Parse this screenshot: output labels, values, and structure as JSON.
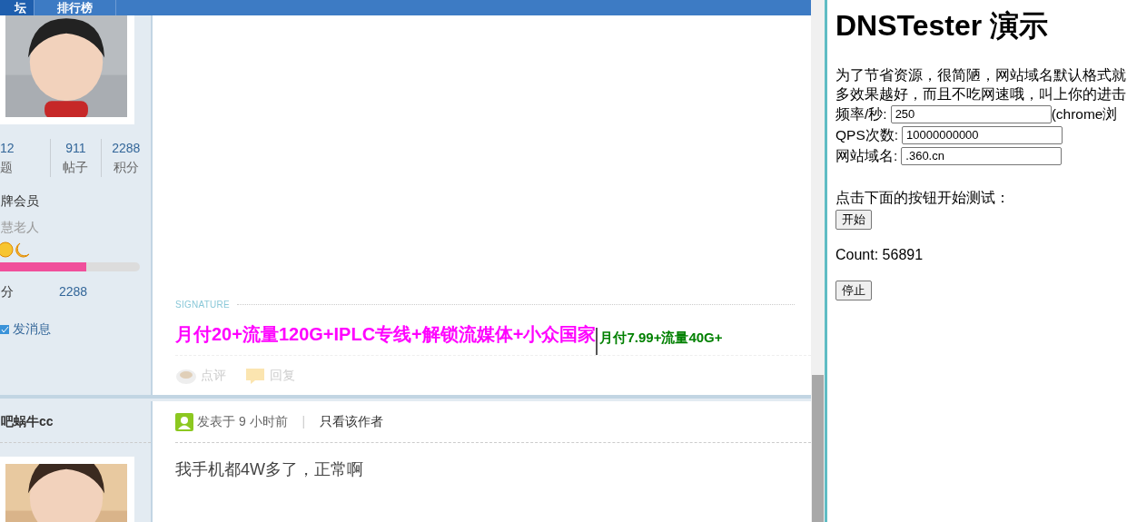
{
  "nav_tabs": [
    {
      "label": "坛",
      "selected": true
    },
    {
      "label": "排行榜",
      "selected": false
    }
  ],
  "post_1": {
    "author_stats": [
      {
        "value": "12",
        "label": "题"
      },
      {
        "value": "911",
        "label": "帖子"
      },
      {
        "value": "2288",
        "label": "积分"
      }
    ],
    "rank": "牌会员",
    "title": "慧老人",
    "level": 0.62,
    "points_label": "分",
    "points_value": "2288",
    "message_link": "发消息",
    "signature_label": "SIGNATURE",
    "signature_parts": [
      {
        "text": "月付20+流量120G+IPLC专线+解锁流媒体+小众国家",
        "color": "#ff00ff"
      },
      {
        "text": "月付7.99+流量40G+",
        "color": "#008000"
      }
    ],
    "actions": [
      {
        "kind": "rate",
        "label": "点评"
      },
      {
        "kind": "reply",
        "label": "回复"
      }
    ]
  },
  "post_2": {
    "author": "吧蜗牛cc",
    "posted": "发表于 9 小时前",
    "separator": "|",
    "author_only": "只看该作者",
    "content": "我手机都4W多了，正常啊"
  },
  "dns_panel": {
    "title": "DNSTester 演示",
    "intro_lines": [
      "为了节省资源，很简陋，网站域名默认格式就",
      "多效果越好，而且不吃网速哦，叫上你的进击"
    ],
    "fields": [
      {
        "label": "频率/秒:",
        "value": "250",
        "note": "(chrome浏"
      },
      {
        "label": "QPS次数:",
        "value": "10000000000"
      },
      {
        "label": "网站域名:",
        "value": ".360.cn"
      }
    ],
    "prompt": "点击下面的按钮开始测试：",
    "start_button": "开始",
    "count": "Count: 56891",
    "stop_button": "停止"
  }
}
